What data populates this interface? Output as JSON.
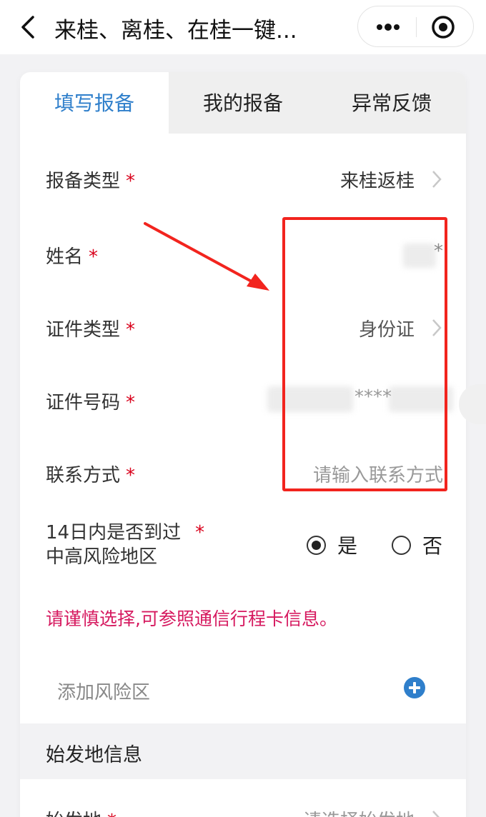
{
  "nav": {
    "title": "来桂、离桂、在桂一键...",
    "back_icon": "chevron-left-icon",
    "more_icon": "more-dots-icon",
    "close_icon": "target-circle-icon"
  },
  "tabs": [
    {
      "label": "填写报备",
      "active": true
    },
    {
      "label": "我的报备",
      "active": false
    },
    {
      "label": "异常反馈",
      "active": false
    }
  ],
  "form": {
    "report_type": {
      "label": "报备类型",
      "required": "*",
      "value": "来桂返桂"
    },
    "name": {
      "label": "姓名",
      "required": "*",
      "value": "*"
    },
    "id_type": {
      "label": "证件类型",
      "required": "*",
      "value": "身份证"
    },
    "id_number": {
      "label": "证件号码",
      "required": "*",
      "value": "****"
    },
    "contact": {
      "label": "联系方式",
      "required": "*",
      "placeholder": "请输入联系方式"
    },
    "risk_question": {
      "label_line1": "14日内是否到过",
      "label_line2": "中高风险地区",
      "required": "*",
      "options": [
        {
          "label": "是",
          "checked": true
        },
        {
          "label": "否",
          "checked": false
        }
      ]
    },
    "notice": "请谨慎选择,可参照通信行程卡信息。",
    "add_risk_label": "添加风险区",
    "section_title": "始发地信息",
    "origin": {
      "label": "始发地",
      "required": "*",
      "placeholder": "请选择始发地"
    }
  },
  "colors": {
    "accent": "#2f7fcb",
    "required": "#d9001b",
    "notice": "#d6195f",
    "annotation": "#f2241e",
    "plus": "#2f7fcb"
  }
}
